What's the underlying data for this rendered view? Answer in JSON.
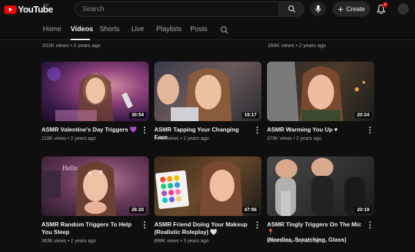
{
  "header": {
    "logo_text": "YouTube",
    "region": "HU",
    "search_placeholder": "Search",
    "create_label": "Create",
    "notifications_count": "8"
  },
  "tabs": [
    {
      "label": "Home"
    },
    {
      "label": "Videos"
    },
    {
      "label": "Shorts"
    },
    {
      "label": "Live"
    },
    {
      "label": "Playlists"
    },
    {
      "label": "Posts"
    }
  ],
  "prev_row": [
    {
      "meta": "202K views • 2 years ago"
    },
    {
      "meta": "266K views • 2 years ago"
    }
  ],
  "videos": [
    {
      "title": "ASMR Valentine's Day Triggers",
      "emoji": "💜",
      "duration": "30:54",
      "views": "219K views",
      "age": "2 years ago"
    },
    {
      "title": "ASMR Tapping Your Changing Face",
      "emoji": "",
      "duration": "19:17",
      "views": "244K views",
      "age": "2 years ago"
    },
    {
      "title": "ASMR Warming You Up",
      "emoji": "♥",
      "duration": "20:24",
      "views": "379K views",
      "age": "2 years ago"
    },
    {
      "title": "ASMR Random Triggers To Help You Sleep",
      "emoji": "",
      "duration": "26:20",
      "views": "363K views",
      "age": "2 years ago"
    },
    {
      "title": "ASMR Friend Doing Your Makeup (Realistic Roleplay)",
      "emoji": "🤍",
      "duration": "47:56",
      "views": "899K views",
      "age": "3 years ago"
    },
    {
      "title": "ASMR Tingly Triggers On The Mic",
      "emoji": "📍",
      "title2": "(Needles, Scratching, Glass)",
      "duration": "20:19",
      "views": "371K views",
      "age": "3 years ago"
    }
  ],
  "colors": {
    "background": "#0f0f0f",
    "brand": "#ff0000",
    "text_primary": "#f1f1f1",
    "text_secondary": "#aaaaaa"
  }
}
